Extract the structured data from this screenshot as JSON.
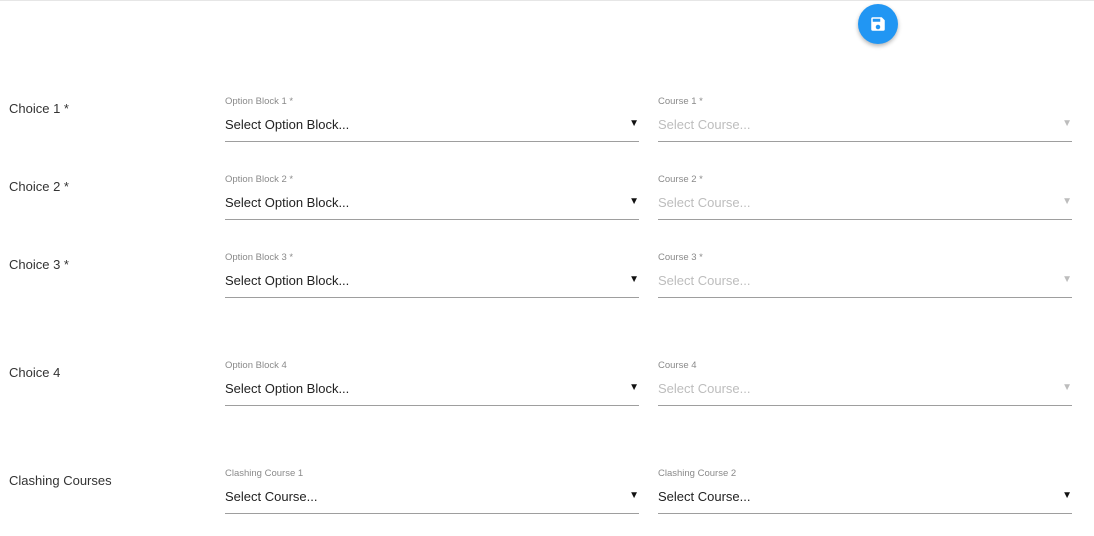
{
  "toolbar": {
    "save_icon": "floppy-disk-icon",
    "accent": "#2196f3"
  },
  "rows": [
    {
      "label": "Choice 1 *",
      "field1": {
        "label": "Option Block 1 *",
        "value": "Select Option Block...",
        "disabled": false
      },
      "field2": {
        "label": "Course 1 *",
        "value": "Select Course...",
        "disabled": true
      }
    },
    {
      "label": "Choice 2 *",
      "field1": {
        "label": "Option Block 2 *",
        "value": "Select Option Block...",
        "disabled": false
      },
      "field2": {
        "label": "Course 2 *",
        "value": "Select Course...",
        "disabled": true
      }
    },
    {
      "label": "Choice 3 *",
      "field1": {
        "label": "Option Block 3 *",
        "value": "Select Option Block...",
        "disabled": false
      },
      "field2": {
        "label": "Course 3 *",
        "value": "Select Course...",
        "disabled": true
      }
    },
    {
      "label": "Choice 4",
      "field1": {
        "label": "Option Block 4",
        "value": "Select Option Block...",
        "disabled": false
      },
      "field2": {
        "label": "Course 4",
        "value": "Select Course...",
        "disabled": true
      }
    },
    {
      "label": "Clashing Courses",
      "field1": {
        "label": "Clashing Course 1",
        "value": "Select Course...",
        "disabled": false
      },
      "field2": {
        "label": "Clashing Course 2",
        "value": "Select Course...",
        "disabled": false
      }
    }
  ],
  "arrow_glyph": "▼"
}
